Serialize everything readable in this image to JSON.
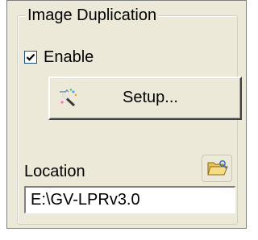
{
  "group": {
    "title": "Image Duplication"
  },
  "enable_checkbox": {
    "label": "Enable",
    "checked": true
  },
  "setup_button": {
    "label": "Setup...",
    "icon": "setup-wand-icon"
  },
  "location": {
    "label": "Location",
    "value": "E:\\GV-LPRv3.0",
    "browse_icon": "folder-open-icon"
  }
}
